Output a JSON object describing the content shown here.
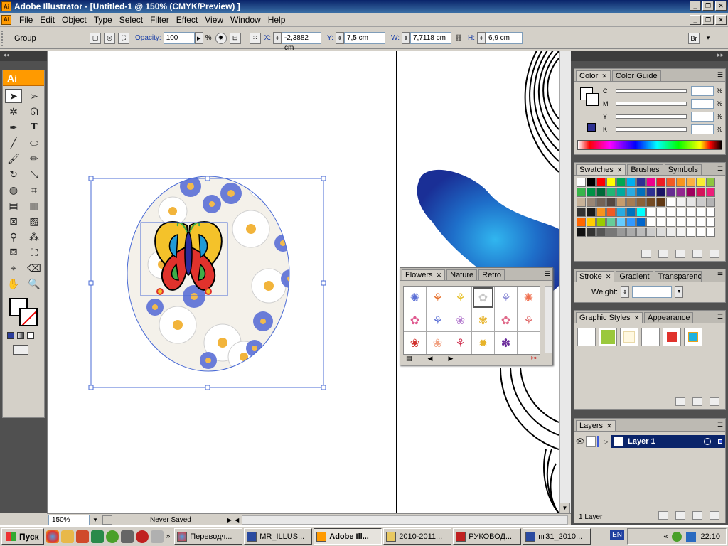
{
  "window": {
    "title": "Adobe Illustrator - [Untitled-1 @ 150% (CMYK/Preview) ]",
    "app_icon": "Ai"
  },
  "menu": [
    "File",
    "Edit",
    "Object",
    "Type",
    "Select",
    "Filter",
    "Effect",
    "View",
    "Window",
    "Help"
  ],
  "control": {
    "selection_label": "Group",
    "opacity_label": "Opacity:",
    "opacity_value": "100",
    "percent": "%",
    "x_label": "X:",
    "x_value": "-2,3882 cm",
    "y_label": "Y:",
    "y_value": "7,5 cm",
    "w_label": "W:",
    "w_value": "7,7118 cm",
    "h_label": "H:",
    "h_value": "6,9 cm"
  },
  "tools": {
    "logo": "Ai"
  },
  "status": {
    "zoom": "150%",
    "text": "Never Saved"
  },
  "color_panel": {
    "tabs": [
      "Color",
      "Color Guide"
    ],
    "sliders": [
      "C",
      "M",
      "Y",
      "K"
    ],
    "percent": "%"
  },
  "swatches_panel": {
    "tabs": [
      "Swatches",
      "Brushes",
      "Symbols"
    ],
    "colors": [
      "#ffffff",
      "#000000",
      "#ff0000",
      "#ffff00",
      "#00a651",
      "#00aeef",
      "#2e3192",
      "#ec008c",
      "#ed1c24",
      "#f15a24",
      "#f7941d",
      "#fbb040",
      "#f9ed32",
      "#8dc63f",
      "#39b54a",
      "#009245",
      "#006837",
      "#22b573",
      "#00a99d",
      "#29abe2",
      "#0071bc",
      "#2e3192",
      "#1b1464",
      "#662d91",
      "#93278f",
      "#9e005d",
      "#d4145a",
      "#ed1e79",
      "#c7b299",
      "#998675",
      "#736357",
      "#534741",
      "#c69c6d",
      "#a67c52",
      "#8c6239",
      "#754c24",
      "#603813",
      "#ffffff",
      "#f2f2f2",
      "#e6e6e6",
      "#cccccc",
      "#b3b3b3",
      "#333333",
      "#1a1a1a",
      "#f7931e",
      "#f15a24",
      "#29abe2",
      "#0071bc",
      "#00ffff",
      "#ffffff",
      "#ffffff",
      "#ffffff",
      "#ffffff",
      "#ffffff",
      "#ffffff",
      "#ffffff",
      "#ff6600",
      "#ffcc00",
      "#99cc00",
      "#66cc99",
      "#66ccff",
      "#3399ff",
      "#0066cc",
      "#ffffff",
      "#ffffff",
      "#ffffff",
      "#ffffff",
      "#ffffff",
      "#ffffff",
      "#ffffff",
      "#111111",
      "#333333",
      "#555555",
      "#777777",
      "#999999",
      "#aaaaaa",
      "#bbbbbb",
      "#cccccc",
      "#dddddd",
      "#eeeeee",
      "#f5f5f5",
      "#ffffff",
      "#ffffff",
      "#ffffff"
    ]
  },
  "stroke_panel": {
    "tabs": [
      "Stroke",
      "Gradient",
      "Transparency"
    ],
    "weight_label": "Weight:"
  },
  "graphic_styles_panel": {
    "tabs": [
      "Graphic Styles",
      "Appearance"
    ]
  },
  "layers_panel": {
    "tab": "Layers",
    "layer_name": "Layer 1",
    "count": "1 Layer"
  },
  "flowers_panel": {
    "tabs": [
      "Flowers",
      "Nature",
      "Retro"
    ]
  },
  "taskbar": {
    "start": "Пуск",
    "tasks": [
      "Переводч...",
      "MR_ILLUS...",
      "Adobe Ill...",
      "2010-2011...",
      "РУКОВОД...",
      "пг31_2010..."
    ],
    "lang": "EN",
    "clock": "22:10"
  }
}
